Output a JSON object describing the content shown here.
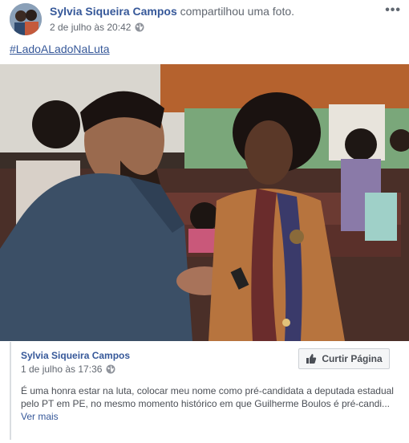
{
  "post": {
    "author_name": "Sylvia Siqueira Campos",
    "action_text": "compartilhou uma foto.",
    "timestamp": "2 de julho às 20:42",
    "hashtag": "#LadoALadoNaLuta",
    "more_icon": "more-options-icon"
  },
  "shared": {
    "author_name": "Sylvia Siqueira Campos",
    "timestamp": "1 de julho às 17:36",
    "like_page_label": "Curtir Página",
    "text": "É uma honra estar na luta, colocar meu nome como pré-candidata a deputada estadual pelo PT em PE, no mesmo momento histórico em que Guilherme Boulos é pré-candi...",
    "see_more": "Ver mais"
  },
  "colors": {
    "link": "#365899",
    "secondary_text": "#616770",
    "body_text": "#4b4f56"
  }
}
